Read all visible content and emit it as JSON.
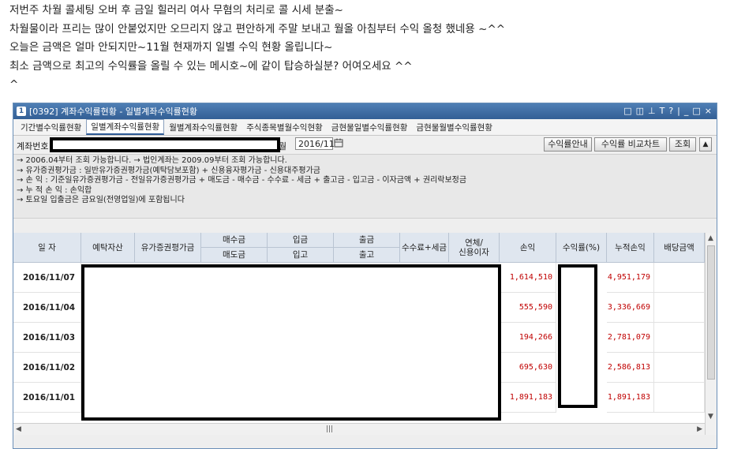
{
  "post": {
    "lines": [
      "저번주 차월 콜세팅 오버 후 금일 힐러리 여사 무혐의 처리로 콜 시세 분출~",
      "차월물이라 프리는 많이 안붙었지만 오므리지 않고 편안하게 주말 보내고 월올 아침부터 수익 올청 했네용 ~^^",
      "오늘은 금액은 얼마 안되지만~11월 현재까지  일별 수익 현황 올립니다~",
      "최소 금액으로 최고의 수익률을 올릴 수 있는 메시호~에 같이 탑승하실분? 어여오세요 ^^",
      "^"
    ]
  },
  "window": {
    "screen_no": "1",
    "title": "[0392] 계좌수익률현황 - 일별계좌수익률현황",
    "title_icons": [
      "□",
      "◫",
      "📌",
      "T",
      "?",
      "|",
      "_",
      "□",
      "×"
    ]
  },
  "tabs": [
    {
      "label": "기간별수익률현황",
      "active": false
    },
    {
      "label": "일별계좌수익률현황",
      "active": true
    },
    {
      "label": "월별계좌수익률현황",
      "active": false
    },
    {
      "label": "주식종목별월수익현황",
      "active": false
    },
    {
      "label": "금현물일별수익률현황",
      "active": false
    },
    {
      "label": "금현물월별수익률현황",
      "active": false
    }
  ],
  "query": {
    "account_label": "계좌번호",
    "month_label": "월",
    "month_value": "2016/11",
    "buttons": {
      "info": "수익률안내",
      "compare": "수익률 비교차트",
      "search": "조회"
    }
  },
  "notes": [
    "→ 2006.04부터 조회 가능합니다. → 법인계좌는 2009.09부터 조회 가능합니다.",
    "→ 유가증권평가금 : 일반유가증권평가금(예탁담보포함) + 신용융자평가금 - 신용대주평가금",
    "→ 손          익 : 기준일유가증권평가금 - 전일유가증권평가금 + 매도금 - 매수금 - 수수료 - 세금 + 출고금 - 입고금 - 이자금액 + 권리락보정금",
    "→ 누  적  손  익 : 손익합",
    "→ 토요일 입출금은 금요일(전영업일)에 포함됩니다"
  ],
  "table": {
    "headers": {
      "date": "일 자",
      "deposit": "예탁자산",
      "securities": "유가증권평가금",
      "buy": "매수금",
      "sell": "매도금",
      "in_amt": "입금",
      "in_goods": "입고",
      "out_amt": "출금",
      "out_goods": "출고",
      "fee_tax": "수수료+세금",
      "interest_l1": "연체/",
      "interest_l2": "신용이자",
      "pnl": "손익",
      "rate": "수익률(%)",
      "cum_pnl": "누적손익",
      "dividend": "배당금액"
    },
    "rows": [
      {
        "date": "2016/11/07",
        "pnl": "1,614,510",
        "cum_pnl": "4,951,179"
      },
      {
        "date": "2016/11/04",
        "pnl": "555,590",
        "cum_pnl": "3,336,669"
      },
      {
        "date": "2016/11/03",
        "pnl": "194,266",
        "cum_pnl": "2,781,079"
      },
      {
        "date": "2016/11/02",
        "pnl": "695,630",
        "cum_pnl": "2,586,813"
      },
      {
        "date": "2016/11/01",
        "pnl": "1,891,183",
        "cum_pnl": "1,891,183"
      }
    ]
  },
  "icons": {
    "calendar": "calendar-icon",
    "scroll_up": "▲",
    "scroll_down": "▼",
    "scroll_left": "◀",
    "scroll_right": "▶",
    "hgrip": "|||"
  }
}
